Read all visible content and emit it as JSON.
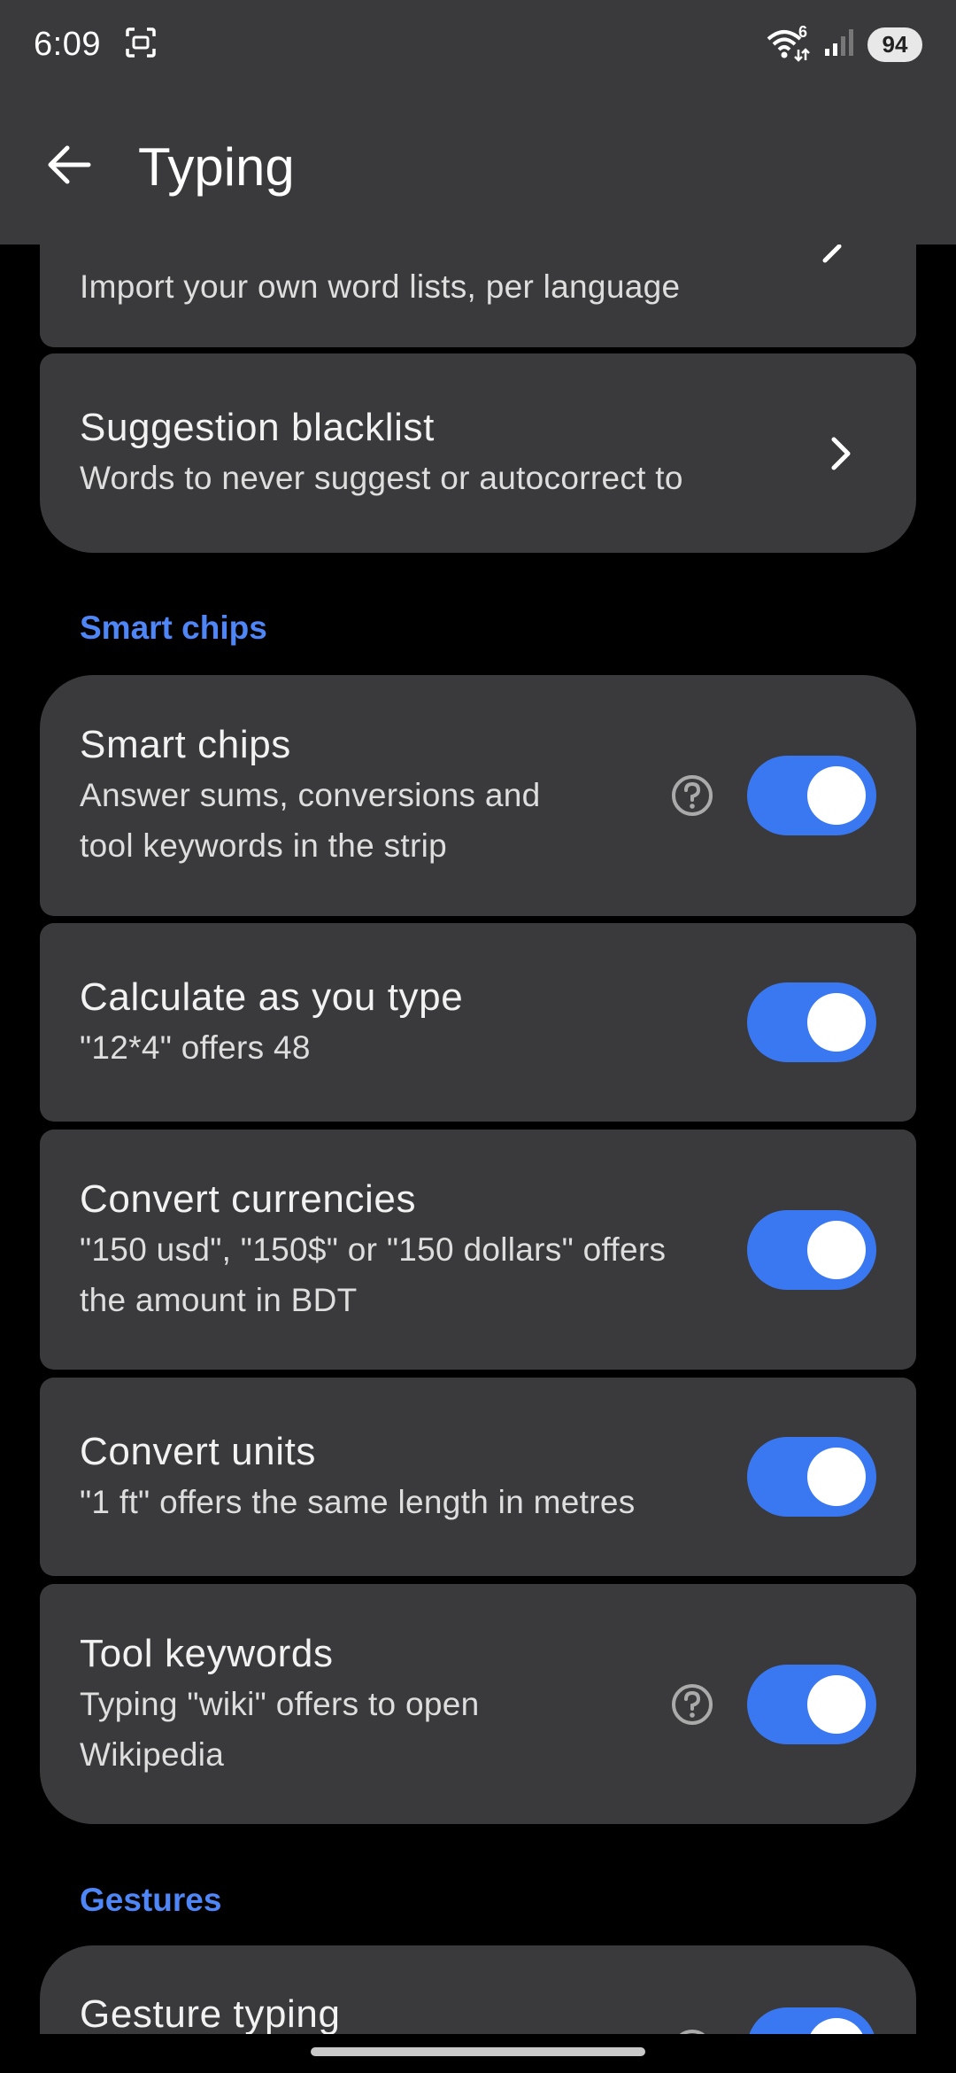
{
  "status_bar": {
    "time": "6:09",
    "wifi_badge": "6",
    "battery": "94"
  },
  "app_bar": {
    "title": "Typing"
  },
  "cards": {
    "import_words": {
      "subtitle": "Import your own word lists, per language"
    },
    "blacklist": {
      "title": "Suggestion blacklist",
      "subtitle": "Words to never suggest or autocorrect to"
    }
  },
  "sections": {
    "smart_chips": "Smart chips",
    "gestures": "Gestures"
  },
  "settings": {
    "smart_chips": {
      "title": "Smart chips",
      "subtitle_1": "Answer sums, conversions and",
      "subtitle_2": "tool keywords in the strip",
      "enabled": true
    },
    "calculate": {
      "title": "Calculate as you type",
      "subtitle": "\"12*4\" offers 48",
      "enabled": true
    },
    "currencies": {
      "title": "Convert currencies",
      "subtitle_1": "\"150 usd\", \"150$\" or \"150 dollars\" offers",
      "subtitle_2": "the amount in BDT",
      "enabled": true
    },
    "units": {
      "title": "Convert units",
      "subtitle": "\"1 ft\" offers the same length in metres",
      "enabled": true
    },
    "tool_keywords": {
      "title": "Tool keywords",
      "subtitle_1": "Typing \"wiki\" offers to open",
      "subtitle_2": "Wikipedia",
      "enabled": true
    },
    "gesture_typing": {
      "title": "Gesture typing",
      "enabled": true
    }
  },
  "colors": {
    "accent": "#3a78f2",
    "section_header": "#4f86f7",
    "card_bg": "#3a3a3c",
    "background": "#000000"
  },
  "icons": {
    "back": "arrow-left-icon",
    "screenshot": "screenshot-icon",
    "wifi": "wifi-icon",
    "signal": "signal-icon",
    "chevron": "chevron-right-icon",
    "help": "help-circle-icon"
  }
}
